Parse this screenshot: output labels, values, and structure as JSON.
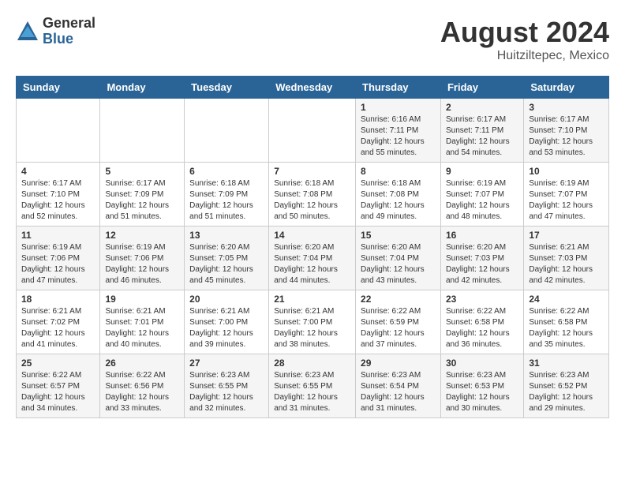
{
  "logo": {
    "general": "General",
    "blue": "Blue"
  },
  "header": {
    "month_year": "August 2024",
    "location": "Huitziltepec, Mexico"
  },
  "days_of_week": [
    "Sunday",
    "Monday",
    "Tuesday",
    "Wednesday",
    "Thursday",
    "Friday",
    "Saturday"
  ],
  "weeks": [
    [
      {
        "day": "",
        "info": ""
      },
      {
        "day": "",
        "info": ""
      },
      {
        "day": "",
        "info": ""
      },
      {
        "day": "",
        "info": ""
      },
      {
        "day": "1",
        "info": "Sunrise: 6:16 AM\nSunset: 7:11 PM\nDaylight: 12 hours\nand 55 minutes."
      },
      {
        "day": "2",
        "info": "Sunrise: 6:17 AM\nSunset: 7:11 PM\nDaylight: 12 hours\nand 54 minutes."
      },
      {
        "day": "3",
        "info": "Sunrise: 6:17 AM\nSunset: 7:10 PM\nDaylight: 12 hours\nand 53 minutes."
      }
    ],
    [
      {
        "day": "4",
        "info": "Sunrise: 6:17 AM\nSunset: 7:10 PM\nDaylight: 12 hours\nand 52 minutes."
      },
      {
        "day": "5",
        "info": "Sunrise: 6:17 AM\nSunset: 7:09 PM\nDaylight: 12 hours\nand 51 minutes."
      },
      {
        "day": "6",
        "info": "Sunrise: 6:18 AM\nSunset: 7:09 PM\nDaylight: 12 hours\nand 51 minutes."
      },
      {
        "day": "7",
        "info": "Sunrise: 6:18 AM\nSunset: 7:08 PM\nDaylight: 12 hours\nand 50 minutes."
      },
      {
        "day": "8",
        "info": "Sunrise: 6:18 AM\nSunset: 7:08 PM\nDaylight: 12 hours\nand 49 minutes."
      },
      {
        "day": "9",
        "info": "Sunrise: 6:19 AM\nSunset: 7:07 PM\nDaylight: 12 hours\nand 48 minutes."
      },
      {
        "day": "10",
        "info": "Sunrise: 6:19 AM\nSunset: 7:07 PM\nDaylight: 12 hours\nand 47 minutes."
      }
    ],
    [
      {
        "day": "11",
        "info": "Sunrise: 6:19 AM\nSunset: 7:06 PM\nDaylight: 12 hours\nand 47 minutes."
      },
      {
        "day": "12",
        "info": "Sunrise: 6:19 AM\nSunset: 7:06 PM\nDaylight: 12 hours\nand 46 minutes."
      },
      {
        "day": "13",
        "info": "Sunrise: 6:20 AM\nSunset: 7:05 PM\nDaylight: 12 hours\nand 45 minutes."
      },
      {
        "day": "14",
        "info": "Sunrise: 6:20 AM\nSunset: 7:04 PM\nDaylight: 12 hours\nand 44 minutes."
      },
      {
        "day": "15",
        "info": "Sunrise: 6:20 AM\nSunset: 7:04 PM\nDaylight: 12 hours\nand 43 minutes."
      },
      {
        "day": "16",
        "info": "Sunrise: 6:20 AM\nSunset: 7:03 PM\nDaylight: 12 hours\nand 42 minutes."
      },
      {
        "day": "17",
        "info": "Sunrise: 6:21 AM\nSunset: 7:03 PM\nDaylight: 12 hours\nand 42 minutes."
      }
    ],
    [
      {
        "day": "18",
        "info": "Sunrise: 6:21 AM\nSunset: 7:02 PM\nDaylight: 12 hours\nand 41 minutes."
      },
      {
        "day": "19",
        "info": "Sunrise: 6:21 AM\nSunset: 7:01 PM\nDaylight: 12 hours\nand 40 minutes."
      },
      {
        "day": "20",
        "info": "Sunrise: 6:21 AM\nSunset: 7:00 PM\nDaylight: 12 hours\nand 39 minutes."
      },
      {
        "day": "21",
        "info": "Sunrise: 6:21 AM\nSunset: 7:00 PM\nDaylight: 12 hours\nand 38 minutes."
      },
      {
        "day": "22",
        "info": "Sunrise: 6:22 AM\nSunset: 6:59 PM\nDaylight: 12 hours\nand 37 minutes."
      },
      {
        "day": "23",
        "info": "Sunrise: 6:22 AM\nSunset: 6:58 PM\nDaylight: 12 hours\nand 36 minutes."
      },
      {
        "day": "24",
        "info": "Sunrise: 6:22 AM\nSunset: 6:58 PM\nDaylight: 12 hours\nand 35 minutes."
      }
    ],
    [
      {
        "day": "25",
        "info": "Sunrise: 6:22 AM\nSunset: 6:57 PM\nDaylight: 12 hours\nand 34 minutes."
      },
      {
        "day": "26",
        "info": "Sunrise: 6:22 AM\nSunset: 6:56 PM\nDaylight: 12 hours\nand 33 minutes."
      },
      {
        "day": "27",
        "info": "Sunrise: 6:23 AM\nSunset: 6:55 PM\nDaylight: 12 hours\nand 32 minutes."
      },
      {
        "day": "28",
        "info": "Sunrise: 6:23 AM\nSunset: 6:55 PM\nDaylight: 12 hours\nand 31 minutes."
      },
      {
        "day": "29",
        "info": "Sunrise: 6:23 AM\nSunset: 6:54 PM\nDaylight: 12 hours\nand 31 minutes."
      },
      {
        "day": "30",
        "info": "Sunrise: 6:23 AM\nSunset: 6:53 PM\nDaylight: 12 hours\nand 30 minutes."
      },
      {
        "day": "31",
        "info": "Sunrise: 6:23 AM\nSunset: 6:52 PM\nDaylight: 12 hours\nand 29 minutes."
      }
    ]
  ]
}
